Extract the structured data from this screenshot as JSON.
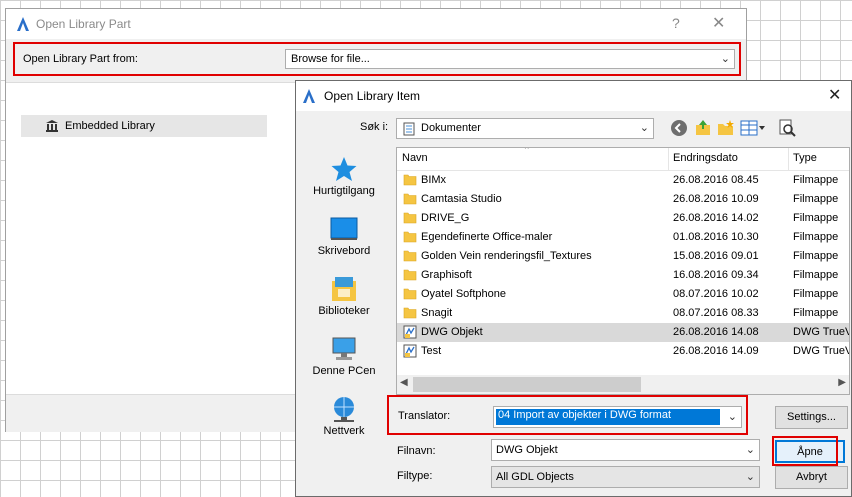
{
  "back_window": {
    "title": "Open Library Part",
    "help_glyph": "?",
    "close_glyph": "✕",
    "from_label": "Open Library Part from:",
    "from_value": "Browse for file...",
    "library_item": "Embedded Library"
  },
  "dialog": {
    "title": "Open Library Item",
    "close_glyph": "✕",
    "look_in_label": "Søk i:",
    "look_in_value": "Dokumenter",
    "places": [
      {
        "label": "Hurtigtilgang",
        "icon": "star-icon"
      },
      {
        "label": "Skrivebord",
        "icon": "desktop-icon"
      },
      {
        "label": "Biblioteker",
        "icon": "libraries-icon"
      },
      {
        "label": "Denne PCen",
        "icon": "computer-icon"
      },
      {
        "label": "Nettverk",
        "icon": "network-icon"
      }
    ],
    "columns": {
      "name": "Navn",
      "date": "Endringsdato",
      "type": "Type"
    },
    "files": [
      {
        "name": "BIMx",
        "date": "26.08.2016 08.45",
        "type": "Filmappe",
        "kind": "folder"
      },
      {
        "name": "Camtasia Studio",
        "date": "26.08.2016 10.09",
        "type": "Filmappe",
        "kind": "folder"
      },
      {
        "name": "DRIVE_G",
        "date": "26.08.2016 14.02",
        "type": "Filmappe",
        "kind": "folder"
      },
      {
        "name": "Egendefinerte Office-maler",
        "date": "01.08.2016 10.30",
        "type": "Filmappe",
        "kind": "folder"
      },
      {
        "name": "Golden Vein renderingsfil_Textures",
        "date": "15.08.2016 09.01",
        "type": "Filmappe",
        "kind": "folder"
      },
      {
        "name": "Graphisoft",
        "date": "16.08.2016 09.34",
        "type": "Filmappe",
        "kind": "folder"
      },
      {
        "name": "Oyatel Softphone",
        "date": "08.07.2016 10.02",
        "type": "Filmappe",
        "kind": "folder"
      },
      {
        "name": "Snagit",
        "date": "08.07.2016 08.33",
        "type": "Filmappe",
        "kind": "folder"
      },
      {
        "name": "DWG Objekt",
        "date": "26.08.2016 14.08",
        "type": "DWG TrueV",
        "kind": "dwg",
        "selected": true
      },
      {
        "name": "Test",
        "date": "26.08.2016 14.09",
        "type": "DWG TrueV",
        "kind": "dwg"
      }
    ],
    "translator_label": "Translator:",
    "translator_value": "04 Import av objekter i DWG format",
    "settings_button": "Settings...",
    "filename_label": "Filnavn:",
    "filename_value": "DWG Objekt",
    "open_button": "Åpne",
    "filetype_label": "Filtype:",
    "filetype_value": "All GDL Objects",
    "cancel_button": "Avbryt"
  },
  "colors": {
    "highlight_red": "#e00000",
    "accent_blue": "#0078d7",
    "folder_yellow": "#f5c542",
    "selection_gray": "#d9d9d9"
  }
}
